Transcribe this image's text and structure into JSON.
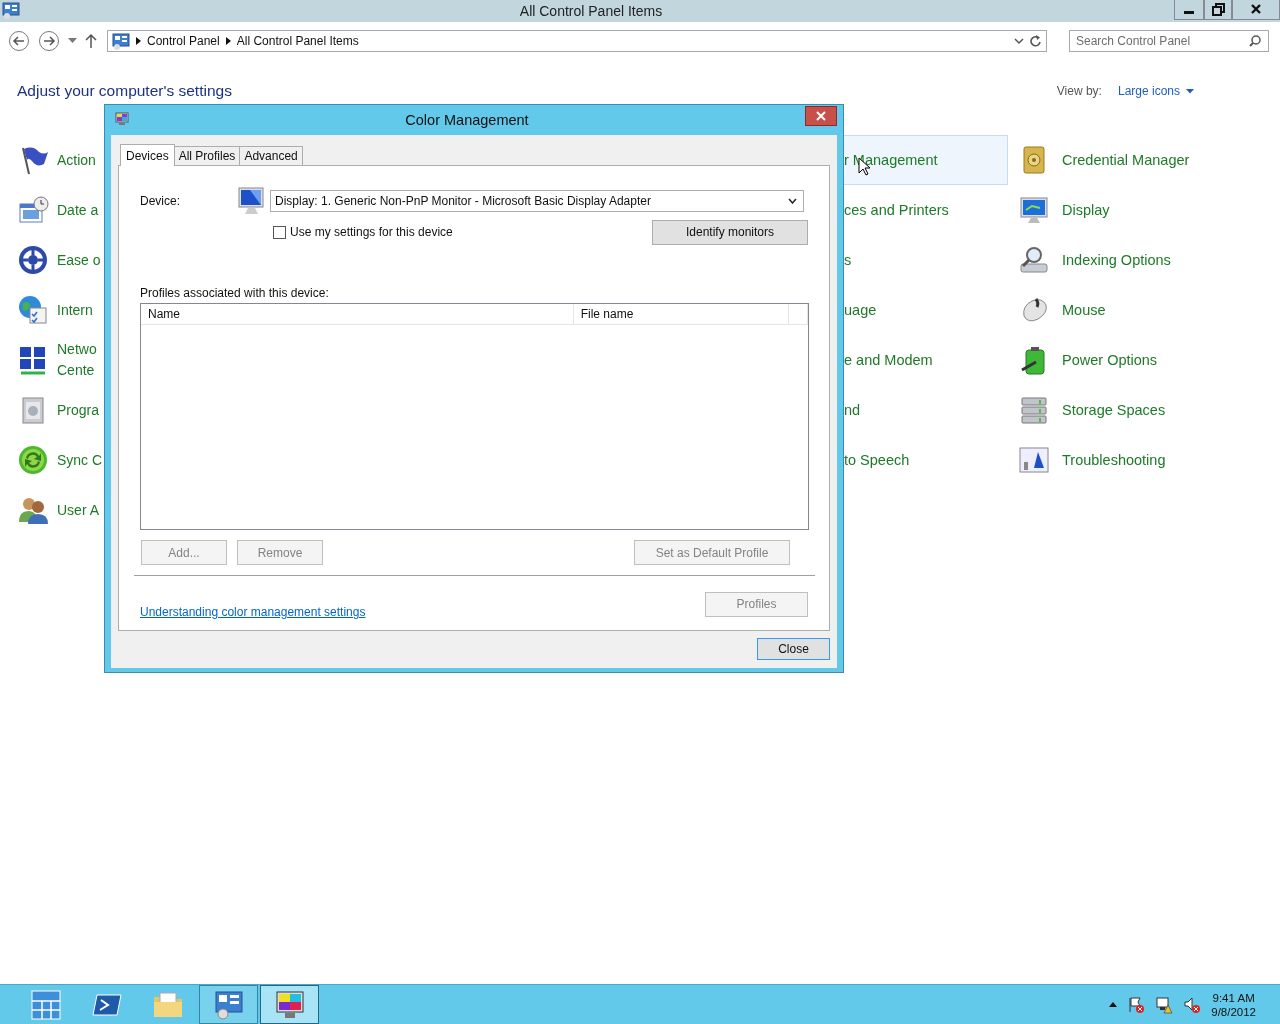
{
  "window": {
    "title": "All Control Panel Items"
  },
  "address_bar": {
    "crumbs": [
      "Control Panel",
      "All Control Panel Items"
    ]
  },
  "search": {
    "placeholder": "Search Control Panel"
  },
  "heading": "Adjust your computer's settings",
  "view_by": {
    "label": "View by:",
    "value": "Large icons"
  },
  "items": {
    "column_1": [
      {
        "label": "Action"
      },
      {
        "label": "Date a"
      },
      {
        "label": "Ease o"
      },
      {
        "label": "Intern"
      },
      {
        "label": "Netwo\nCente"
      },
      {
        "label": "Progra"
      },
      {
        "label": "Sync C"
      },
      {
        "label": "User A"
      }
    ],
    "column_2": [
      {
        "label": "r Management",
        "highlighted": true
      },
      {
        "label": "ces and Printers",
        "highlighted": false
      },
      {
        "label": "s",
        "highlighted": false
      },
      {
        "label": "uage",
        "highlighted": false
      },
      {
        "label": "e and Modem",
        "highlighted": false
      },
      {
        "label": "nd",
        "highlighted": false
      },
      {
        "label": "to Speech",
        "highlighted": false
      }
    ],
    "column_3": [
      {
        "label": "Credential Manager"
      },
      {
        "label": "Display"
      },
      {
        "label": "Indexing Options"
      },
      {
        "label": "Mouse"
      },
      {
        "label": "Power Options"
      },
      {
        "label": "Storage Spaces"
      },
      {
        "label": "Troubleshooting"
      }
    ]
  },
  "dialog": {
    "title": "Color Management",
    "tabs": [
      {
        "label": "Devices",
        "selected": true
      },
      {
        "label": "All Profiles",
        "selected": false
      },
      {
        "label": "Advanced",
        "selected": false
      }
    ],
    "device_label": "Device:",
    "device": "Display: 1. Generic Non-PnP Monitor - Microsoft Basic Display Adapter",
    "use_my_settings": {
      "label": "Use my settings for this device",
      "checked": false
    },
    "identify_button": "Identify monitors",
    "profiles_label": "Profiles associated with this device:",
    "columns": [
      "Name",
      "File name"
    ],
    "buttons": [
      {
        "label": "Add...",
        "disabled": true
      },
      {
        "label": "Remove",
        "disabled": true
      },
      {
        "label": "Set as Default Profile",
        "disabled": true
      }
    ],
    "link": "Understanding color management settings",
    "profiles_button": {
      "label": "Profiles",
      "disabled": true
    },
    "close_button": "Close"
  },
  "taskbar": {
    "apps": [
      {
        "running": false,
        "selected": false
      },
      {
        "running": false,
        "selected": false
      },
      {
        "running": false,
        "selected": false
      },
      {
        "running": true,
        "selected": false
      },
      {
        "running": true,
        "selected": true
      }
    ],
    "time": "9:41 AM",
    "date": "9/8/2012"
  }
}
